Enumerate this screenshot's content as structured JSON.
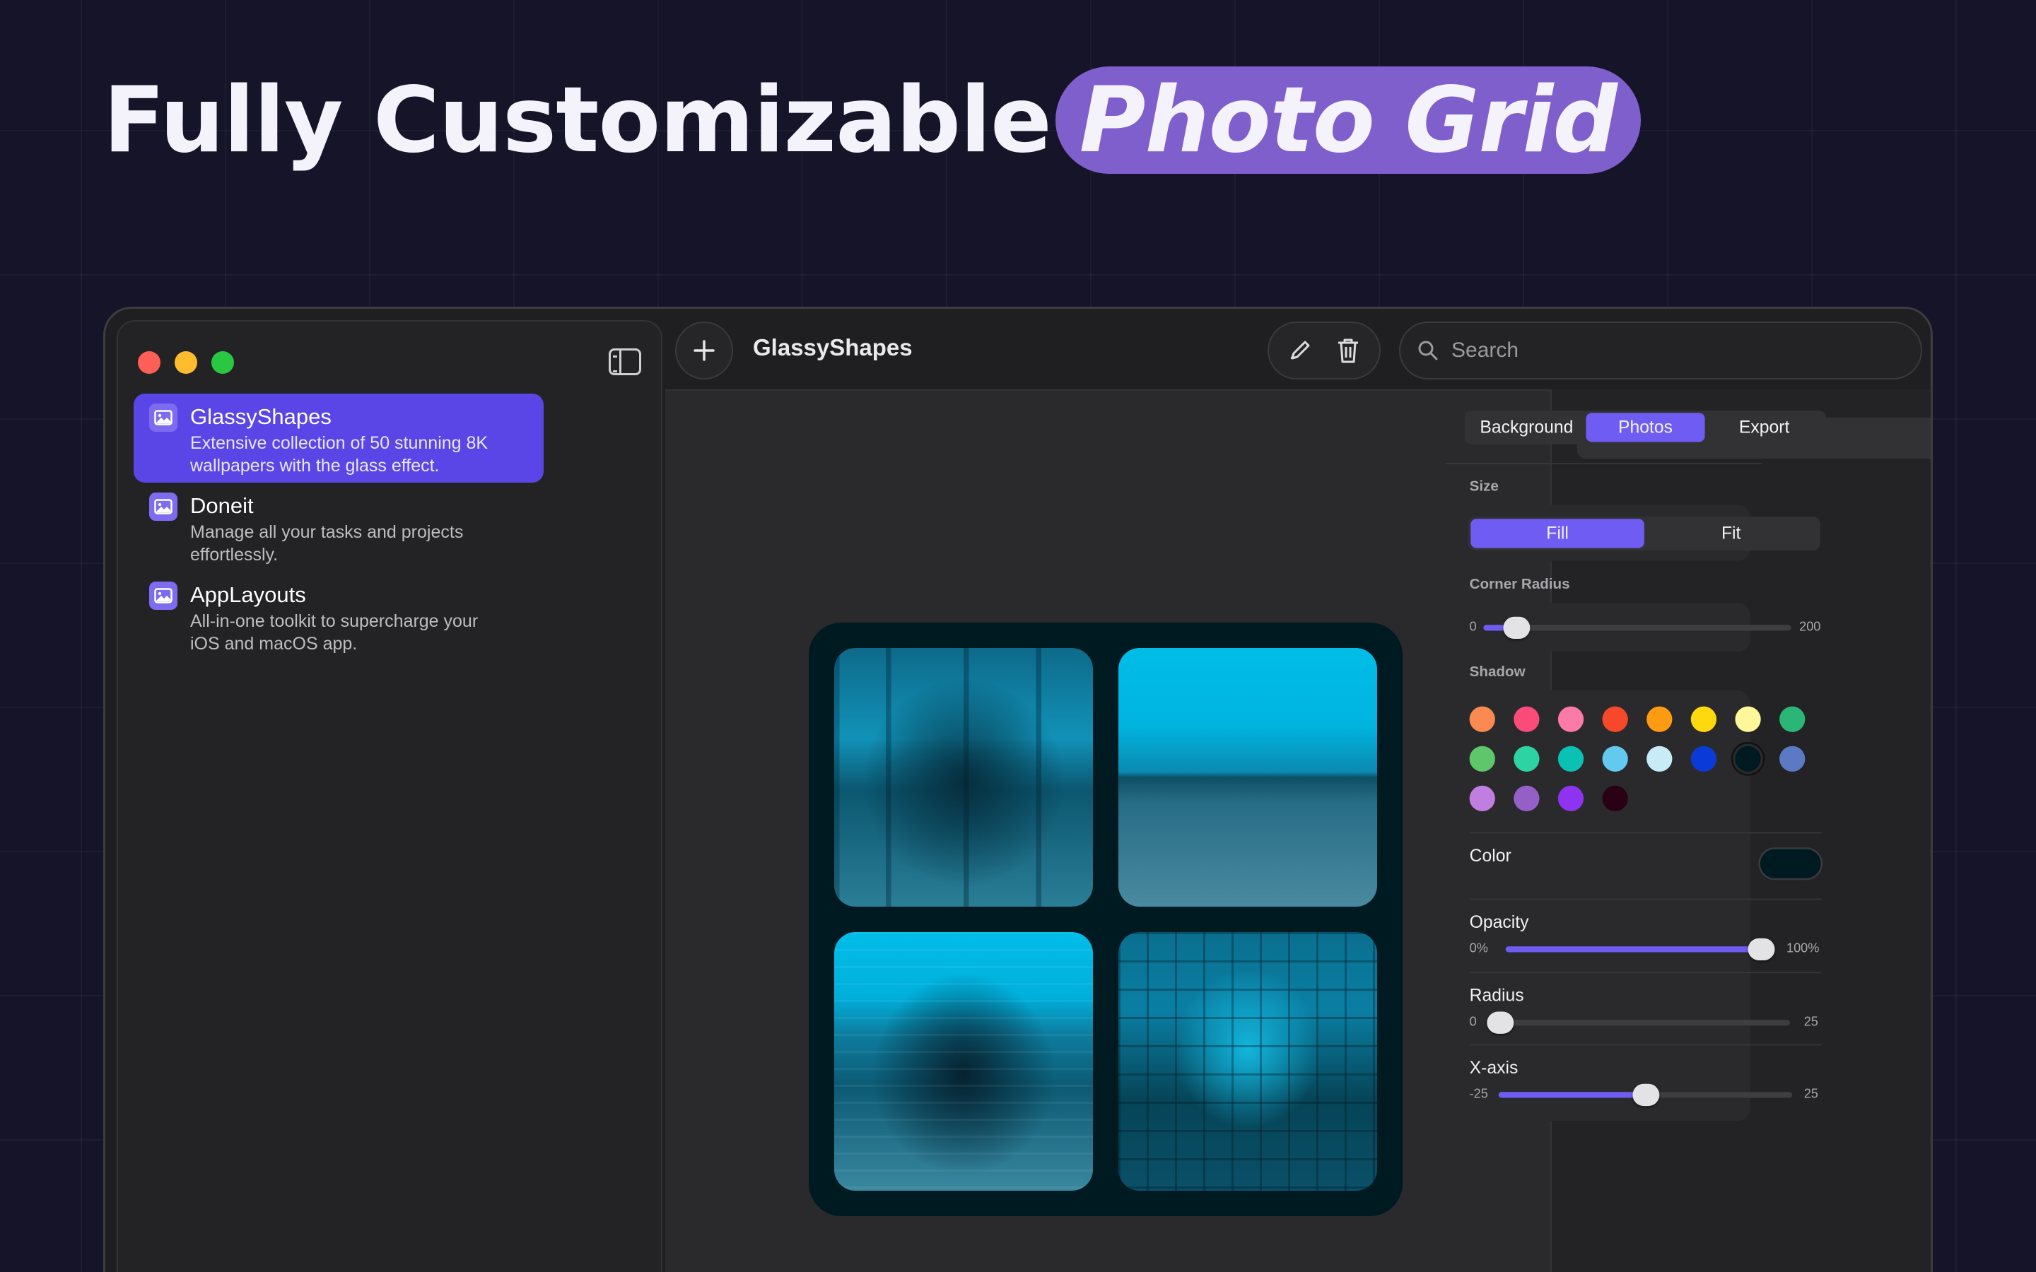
{
  "headline": {
    "main": "Fully Customizable",
    "highlight": "Photo Grid"
  },
  "sidebar": {
    "projects": [
      {
        "title": "GlassyShapes",
        "desc_line1": "Extensive collection of 50 stunning 8K",
        "desc_line2": "wallpapers with the glass effect.",
        "active": true
      },
      {
        "title": "Doneit",
        "desc_line1": "Manage all your tasks and projects",
        "desc_line2": "effortlessly.",
        "active": false
      },
      {
        "title": "AppLayouts",
        "desc_line1": "All-in-one toolkit to supercharge your",
        "desc_line2": "iOS and macOS app.",
        "active": false
      }
    ]
  },
  "toolbar": {
    "title": "GlassyShapes",
    "search_placeholder": "Search"
  },
  "inspector": {
    "tabs": [
      "Background",
      "Photos",
      "Export"
    ],
    "active_tab": "Photos",
    "size": {
      "label": "Size",
      "options": [
        "Fill",
        "Fit"
      ],
      "selected": "Fill"
    },
    "corner_radius": {
      "label": "Corner Radius",
      "min": "0",
      "max": "200",
      "value": 20
    },
    "shadow": {
      "label": "Shadow",
      "swatches": [
        "#fb8a50",
        "#fa4b79",
        "#fb7aa8",
        "#f7492a",
        "#ff9b12",
        "#ffd80e",
        "#fff799",
        "#2bb577",
        "#5fc66c",
        "#2ed3a4",
        "#0bc1b3",
        "#63c9ee",
        "#c7ecf7",
        "#0a3bd8",
        "#001a22",
        "#5c7ac4",
        "#c07ee0",
        "#9460c8",
        "#8e34f0",
        "#2a0014"
      ],
      "selected_index": 14
    },
    "color": {
      "label": "Color",
      "value": "#001a22"
    },
    "opacity": {
      "label": "Opacity",
      "min": "0%",
      "max": "100%",
      "value": 1.0
    },
    "radius": {
      "label": "Radius",
      "min": "0",
      "max": "25",
      "value": 0
    },
    "x_axis": {
      "label": "X-axis",
      "min": "-25",
      "max": "25",
      "value": 0
    }
  }
}
